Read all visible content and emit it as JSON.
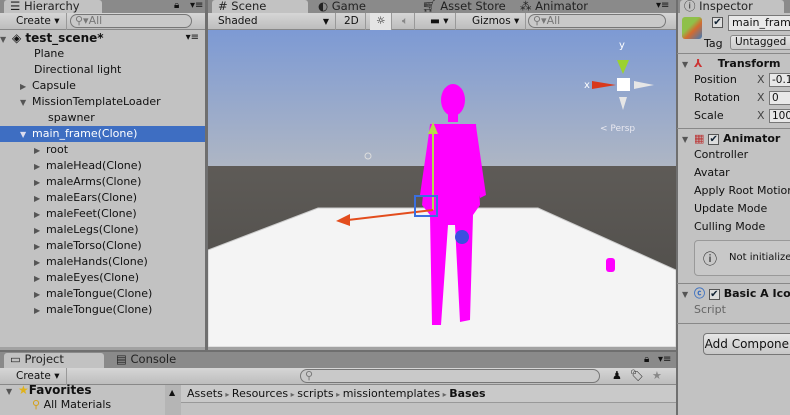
{
  "hierarchy": {
    "tab": "Hierarchy",
    "create": "Create",
    "search_placeholder": "All",
    "scene": "test_scene*",
    "items": [
      {
        "label": "Plane",
        "indent": 1,
        "arrow": false
      },
      {
        "label": "Directional light",
        "indent": 1,
        "arrow": false
      },
      {
        "label": "Capsule",
        "indent": 1,
        "arrow": "right"
      },
      {
        "label": "MissionTemplateLoader",
        "indent": 1,
        "arrow": "down"
      },
      {
        "label": "spawner",
        "indent": 2,
        "arrow": false
      },
      {
        "label": "main_frame(Clone)",
        "indent": 1,
        "arrow": "down",
        "selected": true
      },
      {
        "label": "root",
        "indent": 2,
        "arrow": "right"
      },
      {
        "label": "maleHead(Clone)",
        "indent": 2,
        "arrow": "right"
      },
      {
        "label": "maleArms(Clone)",
        "indent": 2,
        "arrow": "right"
      },
      {
        "label": "maleEars(Clone)",
        "indent": 2,
        "arrow": "right"
      },
      {
        "label": "maleFeet(Clone)",
        "indent": 2,
        "arrow": "right"
      },
      {
        "label": "maleLegs(Clone)",
        "indent": 2,
        "arrow": "right"
      },
      {
        "label": "maleTorso(Clone)",
        "indent": 2,
        "arrow": "right"
      },
      {
        "label": "maleHands(Clone)",
        "indent": 2,
        "arrow": "right"
      },
      {
        "label": "maleEyes(Clone)",
        "indent": 2,
        "arrow": "right"
      },
      {
        "label": "maleTongue(Clone)",
        "indent": 2,
        "arrow": "right"
      },
      {
        "label": "maleTongue(Clone)",
        "indent": 2,
        "arrow": "right"
      }
    ]
  },
  "scene": {
    "tabs": [
      "Scene",
      "Game",
      "Asset Store",
      "Animator"
    ],
    "shading": "Shaded",
    "mode2d": "2D",
    "gizmos": "Gizmos",
    "search_placeholder": "All",
    "axis_y": "y",
    "axis_x": "x",
    "persp": "< Persp"
  },
  "inspector": {
    "tab": "Inspector",
    "object_name": "main_frame(Clone)",
    "tag_label": "Tag",
    "tag_value": "Untagged",
    "transform": {
      "title": "Transform",
      "position_label": "Position",
      "position_x": "-0.1",
      "rotation_label": "Rotation",
      "rotation_x": "0",
      "scale_label": "Scale",
      "scale_x": "100",
      "axis": "X"
    },
    "animator": {
      "title": "Animator",
      "fields": [
        "Controller",
        "Avatar",
        "Apply Root Motion",
        "Update Mode",
        "Culling Mode"
      ],
      "warning": "Not initialized"
    },
    "script_comp": {
      "title": "Basic A Icon",
      "script_label": "Script"
    },
    "add_button": "Add Component"
  },
  "project": {
    "tabs": [
      "Project",
      "Console"
    ],
    "create": "Create",
    "favorites": "Favorites",
    "fav_items": [
      "All Materials"
    ],
    "breadcrumb": [
      "Assets",
      "Resources",
      "scripts",
      "missiontemplates",
      "Bases"
    ]
  }
}
